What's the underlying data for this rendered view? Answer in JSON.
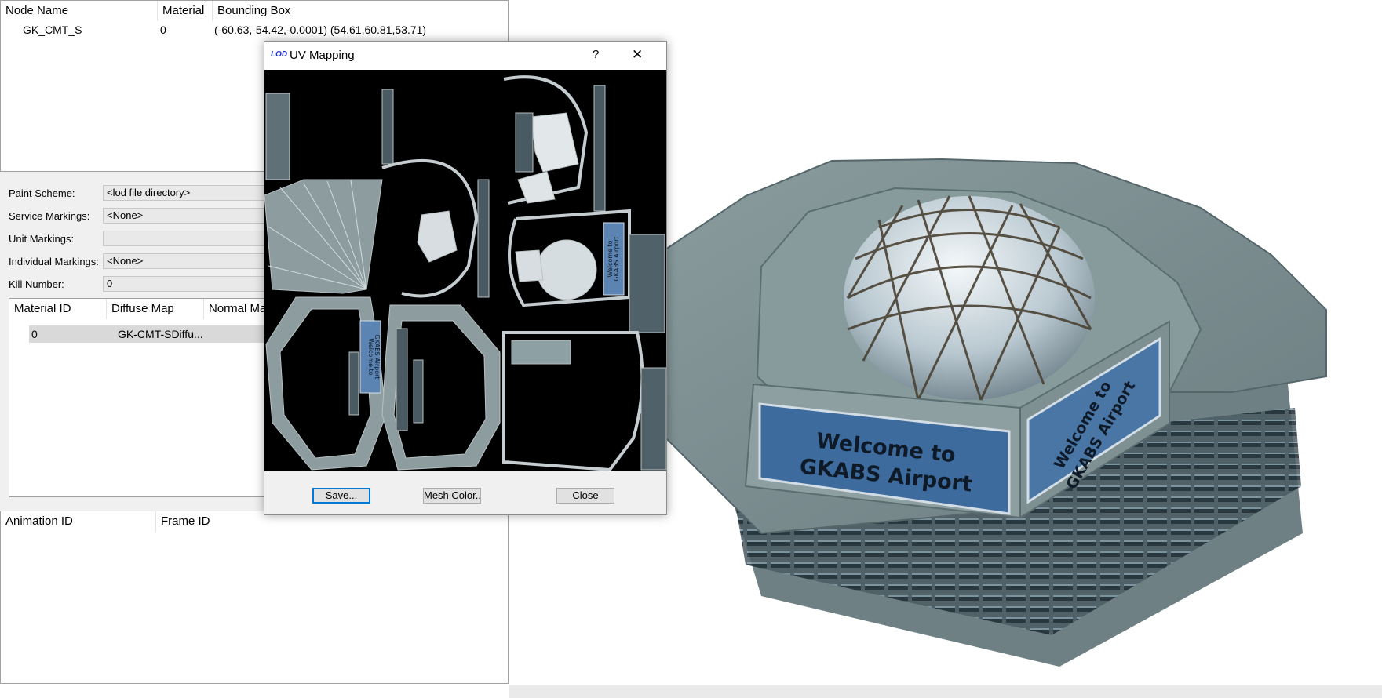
{
  "node_table": {
    "headers": [
      "Node Name",
      "Material",
      "Bounding Box"
    ],
    "rows": [
      {
        "node_name": "GK_CMT_S",
        "material": "0",
        "bounding_box": "(-60.63,-54.42,-0.0001) (54.61,60.81,53.71)"
      }
    ]
  },
  "form": {
    "paint_scheme_label": "Paint Scheme:",
    "paint_scheme_value": "<lod file directory>",
    "service_markings_label": "Service Markings:",
    "service_markings_value": "<None>",
    "unit_markings_label": "Unit Markings:",
    "unit_markings_value": "",
    "individual_markings_label": "Individual Markings:",
    "individual_markings_value": "<None>",
    "kill_number_label": "Kill Number:",
    "kill_number_value": "0"
  },
  "material_table": {
    "headers": [
      "Material ID",
      "Diffuse Map",
      "Normal Ma"
    ],
    "rows": [
      {
        "material_id": "0",
        "diffuse_map": "GK-CMT-SDiffu..."
      }
    ]
  },
  "animation_table": {
    "headers": [
      "Animation ID",
      "Frame ID"
    ]
  },
  "uv_dialog": {
    "title": "UV Mapping",
    "logo_text": "LOD",
    "help_label": "?",
    "close_glyph": "✕",
    "save_label": "Save...",
    "mesh_color_label": "Mesh Color..",
    "close_label": "Close",
    "uv_sign_text_line1": "Welcome to",
    "uv_sign_text_line2": "GKABS Airport"
  },
  "viewport": {
    "sign_front_line1": "Welcome to",
    "sign_front_line2": "GKABS Airport",
    "sign_side_line1": "Welcome to",
    "sign_side_line2": "GKABS Airport"
  },
  "colors": {
    "selection": "#d9d9d9",
    "uv_background": "#000000",
    "uv_wire": "#8f9a9c",
    "building": "#7a8d8f",
    "sign_blue": "#3e6b9e",
    "default_button_border": "#0078d7"
  }
}
